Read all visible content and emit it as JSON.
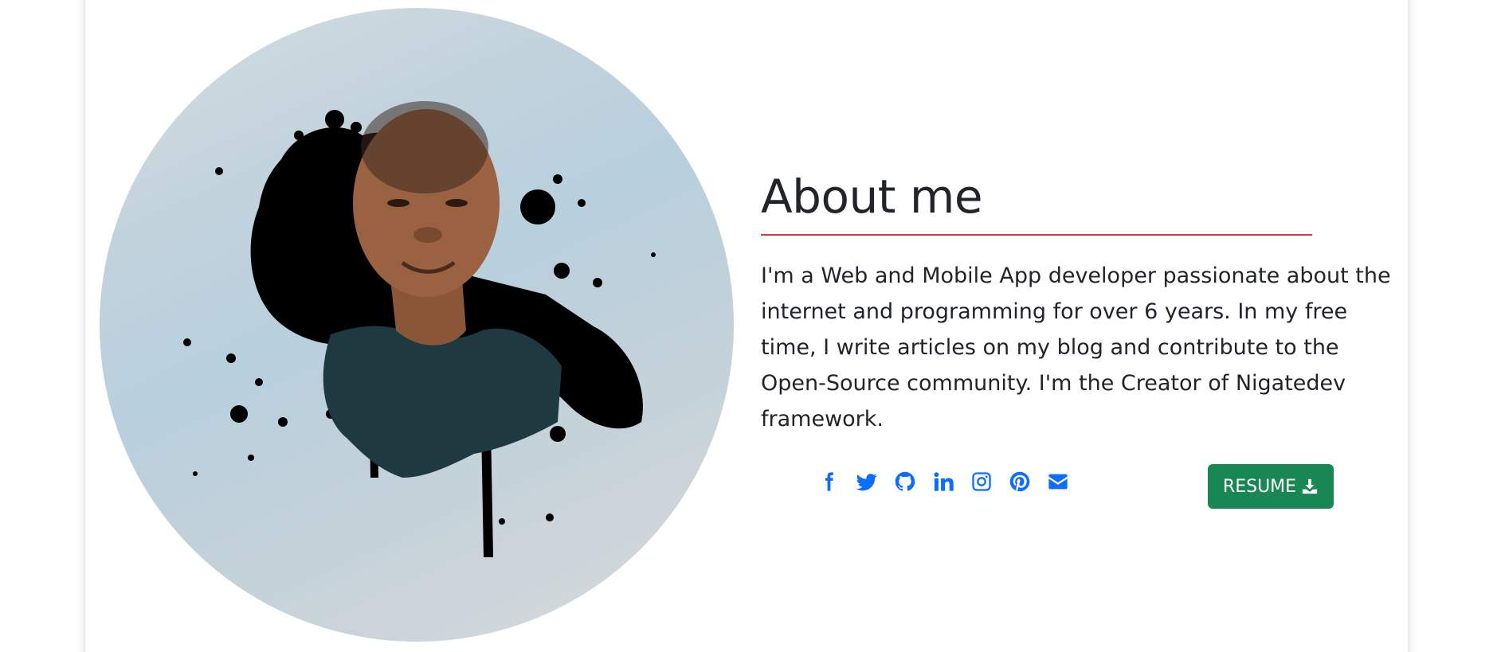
{
  "about": {
    "title": "About me",
    "paragraph": "I'm a Web and Mobile App developer passionate about the internet and programming for over 6 years. In my free time, I write articles on my blog and contribute to the Open-Source community. I'm the Creator of Nigatedev framework."
  },
  "socials": [
    {
      "icon": "facebook-icon"
    },
    {
      "icon": "twitter-icon"
    },
    {
      "icon": "github-icon"
    },
    {
      "icon": "linkedin-icon"
    },
    {
      "icon": "instagram-icon"
    },
    {
      "icon": "pinterest-icon"
    },
    {
      "icon": "envelope-icon"
    }
  ],
  "resume_button": {
    "label": "RESUME",
    "icon": "download-icon"
  },
  "colors": {
    "accent_rule": "#dc3545",
    "social_icons": "#0d6efd",
    "resume_button": "#198754",
    "text": "#212529"
  }
}
